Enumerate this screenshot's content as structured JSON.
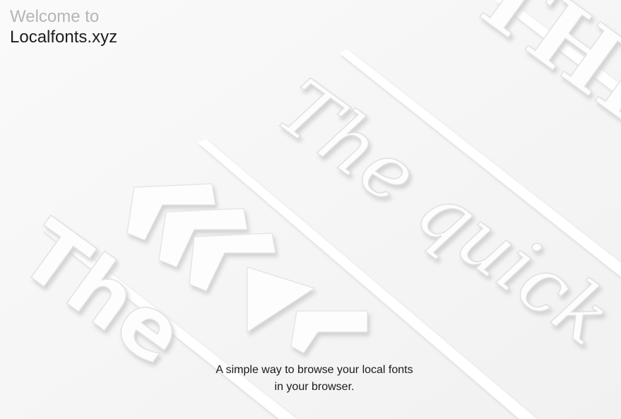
{
  "header": {
    "welcome": "Welcome to",
    "site_name": "Localfonts.xyz"
  },
  "hero": {
    "tagline_line1": "A simple way to browse your local fonts",
    "tagline_line2": "in your browser.",
    "background_words": {
      "big_sans": "THE Q",
      "italic_serif": "The quick",
      "bottom_left": "The"
    },
    "colors": {
      "background": "#f6f6f6",
      "relief_light": "#ffffff",
      "relief_shadow": "#dcdcdc"
    }
  }
}
